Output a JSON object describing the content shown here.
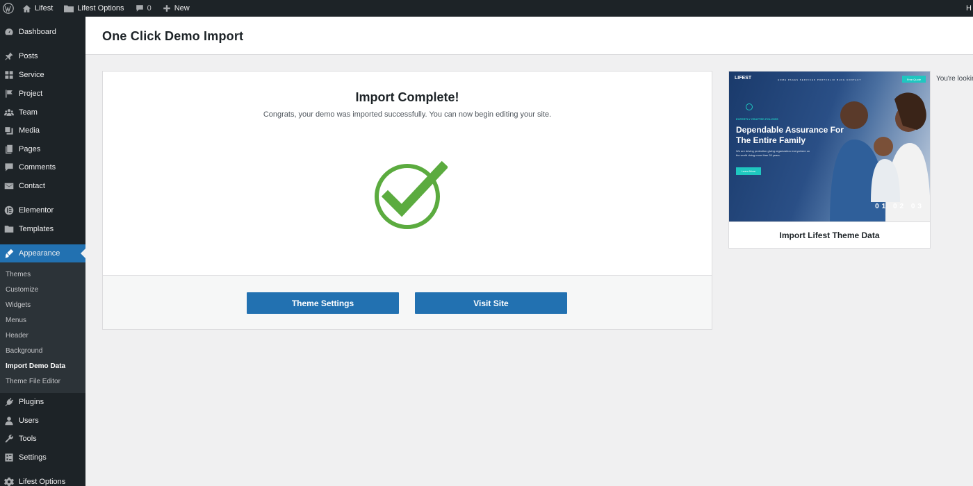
{
  "adminbar": {
    "site_name": "Lifest",
    "options_label": "Lifest Options",
    "comments_count": "0",
    "new_label": "New",
    "right_text": "H"
  },
  "sidebar": {
    "items": [
      {
        "label": "Dashboard",
        "icon": "dashboard-icon"
      },
      {
        "label": "Posts",
        "icon": "pin-icon"
      },
      {
        "label": "Service",
        "icon": "grid-icon"
      },
      {
        "label": "Project",
        "icon": "flag-icon"
      },
      {
        "label": "Team",
        "icon": "users-group-icon"
      },
      {
        "label": "Media",
        "icon": "media-icon"
      },
      {
        "label": "Pages",
        "icon": "pages-icon"
      },
      {
        "label": "Comments",
        "icon": "comment-icon"
      },
      {
        "label": "Contact",
        "icon": "envelope-icon"
      },
      {
        "label": "Elementor",
        "icon": "elementor-icon"
      },
      {
        "label": "Templates",
        "icon": "folder-icon"
      },
      {
        "label": "Appearance",
        "icon": "brush-icon"
      },
      {
        "label": "Plugins",
        "icon": "plug-icon"
      },
      {
        "label": "Users",
        "icon": "user-icon"
      },
      {
        "label": "Tools",
        "icon": "wrench-icon"
      },
      {
        "label": "Settings",
        "icon": "settings-icon"
      },
      {
        "label": "Lifest Options",
        "icon": "gear-icon"
      }
    ],
    "submenu": [
      {
        "label": "Themes"
      },
      {
        "label": "Customize"
      },
      {
        "label": "Widgets"
      },
      {
        "label": "Menus"
      },
      {
        "label": "Header"
      },
      {
        "label": "Background"
      },
      {
        "label": "Import Demo Data"
      },
      {
        "label": "Theme File Editor"
      }
    ]
  },
  "page": {
    "title": "One Click Demo Import"
  },
  "result": {
    "title": "Import Complete!",
    "message": "Congrats, your demo was imported successfully. You can now begin editing your site.",
    "theme_settings_label": "Theme Settings",
    "visit_site_label": "Visit Site"
  },
  "theme": {
    "name": "Import Lifest Theme Data",
    "looking_text": "You're lookin",
    "preview": {
      "logo": "LIFEST",
      "nav": "HOME  PAGES  SERVICES  PORTFOLIO  BLOG  CONTACT",
      "quote_label": "Free Quote",
      "kicker": "EXPERTLY CRAFTED POLICIES",
      "headline": "Dependable Assurance For The Entire Family",
      "text": "We are driving protection giving organization everywhere on the world doing more than 20 years.",
      "button": "Learn More",
      "slides": "01 02 03"
    }
  },
  "colors": {
    "accent": "#2271b1",
    "success": "#5bab3f",
    "sidebar_bg": "#1d2327"
  }
}
